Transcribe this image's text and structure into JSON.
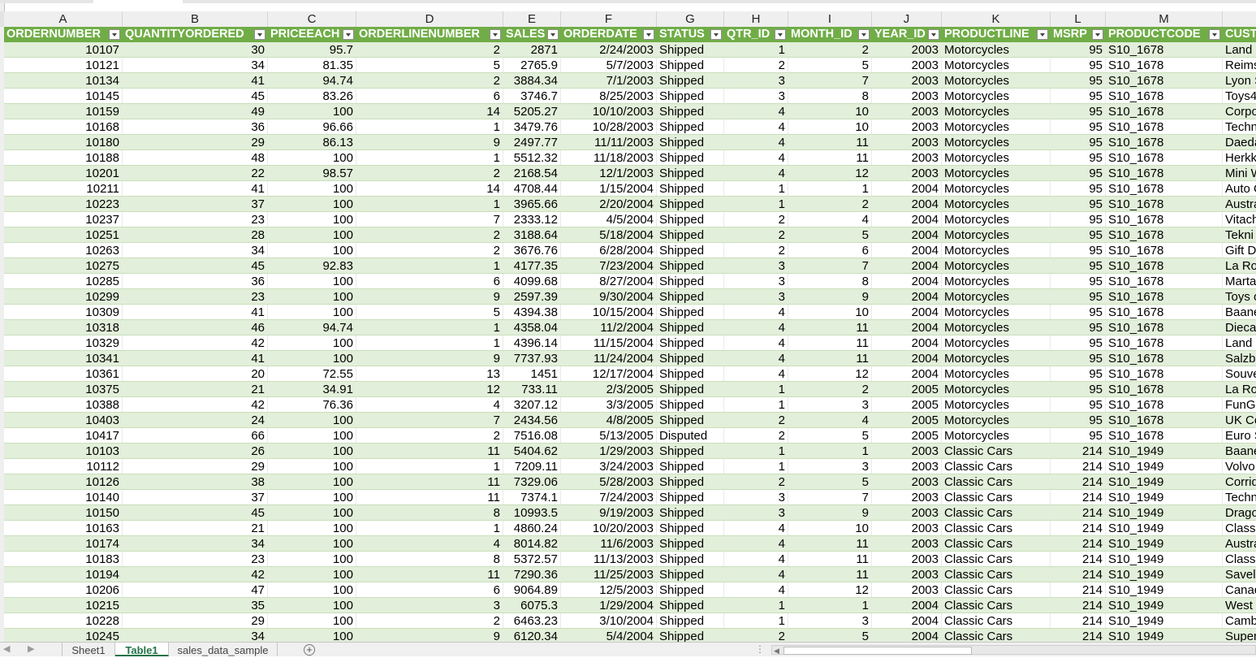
{
  "columns": [
    "A",
    "B",
    "C",
    "D",
    "E",
    "F",
    "G",
    "H",
    "I",
    "J",
    "K",
    "L",
    "M",
    ""
  ],
  "headers": [
    "ORDERNUMBER",
    "QUANTITYORDERED",
    "PRICEEACH",
    "ORDERLINENUMBER",
    "SALES",
    "ORDERDATE",
    "STATUS",
    "QTR_ID",
    "MONTH_ID",
    "YEAR_ID",
    "PRODUCTLINE",
    "MSRP",
    "PRODUCTCODE",
    "CUST"
  ],
  "rows": [
    [
      "10107",
      "30",
      "95.7",
      "2",
      "2871",
      "2/24/2003",
      "Shipped",
      "1",
      "2",
      "2003",
      "Motorcycles",
      "95",
      "S10_1678",
      "Land o"
    ],
    [
      "10121",
      "34",
      "81.35",
      "5",
      "2765.9",
      "5/7/2003",
      "Shipped",
      "2",
      "5",
      "2003",
      "Motorcycles",
      "95",
      "S10_1678",
      "Reims"
    ],
    [
      "10134",
      "41",
      "94.74",
      "2",
      "3884.34",
      "7/1/2003",
      "Shipped",
      "3",
      "7",
      "2003",
      "Motorcycles",
      "95",
      "S10_1678",
      "Lyon S"
    ],
    [
      "10145",
      "45",
      "83.26",
      "6",
      "3746.7",
      "8/25/2003",
      "Shipped",
      "3",
      "8",
      "2003",
      "Motorcycles",
      "95",
      "S10_1678",
      "Toys4"
    ],
    [
      "10159",
      "49",
      "100",
      "14",
      "5205.27",
      "10/10/2003",
      "Shipped",
      "4",
      "10",
      "2003",
      "Motorcycles",
      "95",
      "S10_1678",
      "Corpo"
    ],
    [
      "10168",
      "36",
      "96.66",
      "1",
      "3479.76",
      "10/28/2003",
      "Shipped",
      "4",
      "10",
      "2003",
      "Motorcycles",
      "95",
      "S10_1678",
      "Techn"
    ],
    [
      "10180",
      "29",
      "86.13",
      "9",
      "2497.77",
      "11/11/2003",
      "Shipped",
      "4",
      "11",
      "2003",
      "Motorcycles",
      "95",
      "S10_1678",
      "Daeda"
    ],
    [
      "10188",
      "48",
      "100",
      "1",
      "5512.32",
      "11/18/2003",
      "Shipped",
      "4",
      "11",
      "2003",
      "Motorcycles",
      "95",
      "S10_1678",
      "Herkku"
    ],
    [
      "10201",
      "22",
      "98.57",
      "2",
      "2168.54",
      "12/1/2003",
      "Shipped",
      "4",
      "12",
      "2003",
      "Motorcycles",
      "95",
      "S10_1678",
      "Mini W"
    ],
    [
      "10211",
      "41",
      "100",
      "14",
      "4708.44",
      "1/15/2004",
      "Shipped",
      "1",
      "1",
      "2004",
      "Motorcycles",
      "95",
      "S10_1678",
      "Auto C"
    ],
    [
      "10223",
      "37",
      "100",
      "1",
      "3965.66",
      "2/20/2004",
      "Shipped",
      "1",
      "2",
      "2004",
      "Motorcycles",
      "95",
      "S10_1678",
      "Austra"
    ],
    [
      "10237",
      "23",
      "100",
      "7",
      "2333.12",
      "4/5/2004",
      "Shipped",
      "2",
      "4",
      "2004",
      "Motorcycles",
      "95",
      "S10_1678",
      "Vitach"
    ],
    [
      "10251",
      "28",
      "100",
      "2",
      "3188.64",
      "5/18/2004",
      "Shipped",
      "2",
      "5",
      "2004",
      "Motorcycles",
      "95",
      "S10_1678",
      "Tekni"
    ],
    [
      "10263",
      "34",
      "100",
      "2",
      "3676.76",
      "6/28/2004",
      "Shipped",
      "2",
      "6",
      "2004",
      "Motorcycles",
      "95",
      "S10_1678",
      "Gift D"
    ],
    [
      "10275",
      "45",
      "92.83",
      "1",
      "4177.35",
      "7/23/2004",
      "Shipped",
      "3",
      "7",
      "2004",
      "Motorcycles",
      "95",
      "S10_1678",
      "La Ro"
    ],
    [
      "10285",
      "36",
      "100",
      "6",
      "4099.68",
      "8/27/2004",
      "Shipped",
      "3",
      "8",
      "2004",
      "Motorcycles",
      "95",
      "S10_1678",
      "Marta'"
    ],
    [
      "10299",
      "23",
      "100",
      "9",
      "2597.39",
      "9/30/2004",
      "Shipped",
      "3",
      "9",
      "2004",
      "Motorcycles",
      "95",
      "S10_1678",
      "Toys o"
    ],
    [
      "10309",
      "41",
      "100",
      "5",
      "4394.38",
      "10/15/2004",
      "Shipped",
      "4",
      "10",
      "2004",
      "Motorcycles",
      "95",
      "S10_1678",
      "Baane"
    ],
    [
      "10318",
      "46",
      "94.74",
      "1",
      "4358.04",
      "11/2/2004",
      "Shipped",
      "4",
      "11",
      "2004",
      "Motorcycles",
      "95",
      "S10_1678",
      "Dieca"
    ],
    [
      "10329",
      "42",
      "100",
      "1",
      "4396.14",
      "11/15/2004",
      "Shipped",
      "4",
      "11",
      "2004",
      "Motorcycles",
      "95",
      "S10_1678",
      "Land o"
    ],
    [
      "10341",
      "41",
      "100",
      "9",
      "7737.93",
      "11/24/2004",
      "Shipped",
      "4",
      "11",
      "2004",
      "Motorcycles",
      "95",
      "S10_1678",
      "Salzbu"
    ],
    [
      "10361",
      "20",
      "72.55",
      "13",
      "1451",
      "12/17/2004",
      "Shipped",
      "4",
      "12",
      "2004",
      "Motorcycles",
      "95",
      "S10_1678",
      "Souve"
    ],
    [
      "10375",
      "21",
      "34.91",
      "12",
      "733.11",
      "2/3/2005",
      "Shipped",
      "1",
      "2",
      "2005",
      "Motorcycles",
      "95",
      "S10_1678",
      "La Ro"
    ],
    [
      "10388",
      "42",
      "76.36",
      "4",
      "3207.12",
      "3/3/2005",
      "Shipped",
      "1",
      "3",
      "2005",
      "Motorcycles",
      "95",
      "S10_1678",
      "FunGi"
    ],
    [
      "10403",
      "24",
      "100",
      "7",
      "2434.56",
      "4/8/2005",
      "Shipped",
      "2",
      "4",
      "2005",
      "Motorcycles",
      "95",
      "S10_1678",
      "UK Co"
    ],
    [
      "10417",
      "66",
      "100",
      "2",
      "7516.08",
      "5/13/2005",
      "Disputed",
      "2",
      "5",
      "2005",
      "Motorcycles",
      "95",
      "S10_1678",
      "Euro S"
    ],
    [
      "10103",
      "26",
      "100",
      "11",
      "5404.62",
      "1/29/2003",
      "Shipped",
      "1",
      "1",
      "2003",
      "Classic Cars",
      "214",
      "S10_1949",
      "Baane"
    ],
    [
      "10112",
      "29",
      "100",
      "1",
      "7209.11",
      "3/24/2003",
      "Shipped",
      "1",
      "3",
      "2003",
      "Classic Cars",
      "214",
      "S10_1949",
      "Volvo"
    ],
    [
      "10126",
      "38",
      "100",
      "11",
      "7329.06",
      "5/28/2003",
      "Shipped",
      "2",
      "5",
      "2003",
      "Classic Cars",
      "214",
      "S10_1949",
      "Corrid"
    ],
    [
      "10140",
      "37",
      "100",
      "11",
      "7374.1",
      "7/24/2003",
      "Shipped",
      "3",
      "7",
      "2003",
      "Classic Cars",
      "214",
      "S10_1949",
      "Techn"
    ],
    [
      "10150",
      "45",
      "100",
      "8",
      "10993.5",
      "9/19/2003",
      "Shipped",
      "3",
      "9",
      "2003",
      "Classic Cars",
      "214",
      "S10_1949",
      "Drago"
    ],
    [
      "10163",
      "21",
      "100",
      "1",
      "4860.24",
      "10/20/2003",
      "Shipped",
      "4",
      "10",
      "2003",
      "Classic Cars",
      "214",
      "S10_1949",
      "Classi"
    ],
    [
      "10174",
      "34",
      "100",
      "4",
      "8014.82",
      "11/6/2003",
      "Shipped",
      "4",
      "11",
      "2003",
      "Classic Cars",
      "214",
      "S10_1949",
      "Austra"
    ],
    [
      "10183",
      "23",
      "100",
      "8",
      "5372.57",
      "11/13/2003",
      "Shipped",
      "4",
      "11",
      "2003",
      "Classic Cars",
      "214",
      "S10_1949",
      "Classi"
    ],
    [
      "10194",
      "42",
      "100",
      "11",
      "7290.36",
      "11/25/2003",
      "Shipped",
      "4",
      "11",
      "2003",
      "Classic Cars",
      "214",
      "S10_1949",
      "Savele"
    ],
    [
      "10206",
      "47",
      "100",
      "6",
      "9064.89",
      "12/5/2003",
      "Shipped",
      "4",
      "12",
      "2003",
      "Classic Cars",
      "214",
      "S10_1949",
      "Canad"
    ],
    [
      "10215",
      "35",
      "100",
      "3",
      "6075.3",
      "1/29/2004",
      "Shipped",
      "1",
      "1",
      "2004",
      "Classic Cars",
      "214",
      "S10_1949",
      "West"
    ],
    [
      "10228",
      "29",
      "100",
      "2",
      "6463.23",
      "3/10/2004",
      "Shipped",
      "1",
      "3",
      "2004",
      "Classic Cars",
      "214",
      "S10_1949",
      "Camb"
    ],
    [
      "10245",
      "34",
      "100",
      "9",
      "6120.34",
      "5/4/2004",
      "Shipped",
      "2",
      "5",
      "2004",
      "Classic Cars",
      "214",
      "S10_1949",
      "Super"
    ]
  ],
  "sheet_tabs": [
    "Sheet1",
    "Table1",
    "sales_data_sample"
  ],
  "active_tab": "Table1",
  "colors": {
    "header_green": "#70ad47",
    "band_green": "#e2efda",
    "active_tab_green": "#217346"
  }
}
